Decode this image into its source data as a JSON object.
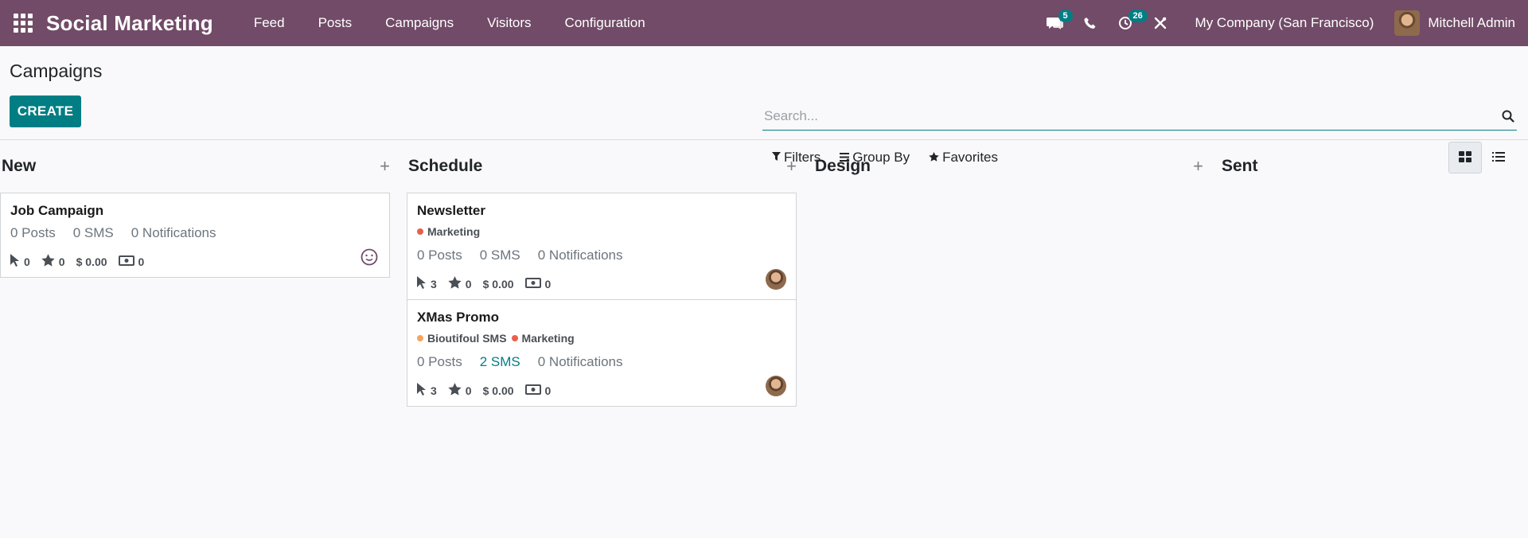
{
  "navbar": {
    "brand": "Social Marketing",
    "menu": [
      "Feed",
      "Posts",
      "Campaigns",
      "Visitors",
      "Configuration"
    ],
    "messages_badge": "5",
    "activities_badge": "26",
    "company": "My Company (San Francisco)",
    "user": "Mitchell Admin",
    "color": "#714b67"
  },
  "control_panel": {
    "breadcrumb": "Campaigns",
    "create_label": "CREATE",
    "search_placeholder": "Search...",
    "filters_label": "Filters",
    "group_by_label": "Group By",
    "favorites_label": "Favorites"
  },
  "columns": [
    {
      "title": "New"
    },
    {
      "title": "Schedule"
    },
    {
      "title": "Design"
    },
    {
      "title": "Sent"
    }
  ],
  "cards": {
    "job": {
      "title": "Job Campaign",
      "posts": "0 Posts",
      "sms": "0 SMS",
      "notifications": "0 Notifications",
      "clicks": "0",
      "stars": "0",
      "revenue": "$ 0.00",
      "cash": "0"
    },
    "newsletter": {
      "title": "Newsletter",
      "tags": [
        "Marketing"
      ],
      "posts": "0 Posts",
      "sms": "0 SMS",
      "notifications": "0 Notifications",
      "clicks": "3",
      "stars": "0",
      "revenue": "$ 0.00",
      "cash": "0"
    },
    "xmas": {
      "title": "XMas Promo",
      "tags": [
        "Bioutifoul SMS",
        "Marketing"
      ],
      "posts": "0 Posts",
      "sms": "2 SMS",
      "notifications": "0 Notifications",
      "clicks": "3",
      "stars": "0",
      "revenue": "$ 0.00",
      "cash": "0"
    }
  },
  "colors": {
    "primary": "#017e84",
    "tag_marketing": "#e8604c",
    "tag_sms": "#f4a460"
  }
}
